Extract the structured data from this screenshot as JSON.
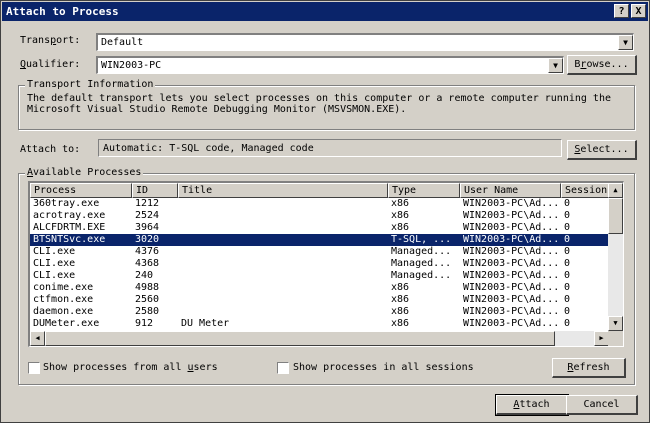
{
  "window": {
    "title": "Attach to Process",
    "help_label": "?",
    "close_label": "X"
  },
  "transport": {
    "label_pre": "Trans",
    "label_key": "p",
    "label_post": "ort:",
    "value": "Default"
  },
  "qualifier": {
    "label_key": "Q",
    "label_post": "ualifier:",
    "value": "WIN2003-PC",
    "browse_pre": "B",
    "browse_key": "r",
    "browse_post": "owse..."
  },
  "transport_info": {
    "title": "Transport Information",
    "line1": "The default transport lets you select processes on this computer or a remote computer running the",
    "line2": "Microsoft Visual Studio Remote Debugging Monitor (MSVSMON.EXE)."
  },
  "attach_to": {
    "label": "Attach to:",
    "value": "Automatic: T-SQL code, Managed code",
    "select_key": "S",
    "select_post": "elect..."
  },
  "available": {
    "title_key": "A",
    "title_post": "vailable Processes",
    "columns": [
      "Process",
      "ID",
      "Title",
      "Type",
      "User Name",
      "Session"
    ],
    "rows": [
      [
        "360tray.exe",
        "1212",
        "",
        "x86",
        "WIN2003-PC\\Ad...",
        "0"
      ],
      [
        "acrotray.exe",
        "2524",
        "",
        "x86",
        "WIN2003-PC\\Ad...",
        "0"
      ],
      [
        "ALCFDRTM.EXE",
        "3964",
        "",
        "x86",
        "WIN2003-PC\\Ad...",
        "0"
      ],
      [
        "BTSNTSvc.exe",
        "3020",
        "",
        "T-SQL, ...",
        "WIN2003-PC\\Ad...",
        "0"
      ],
      [
        "CLI.exe",
        "4376",
        "",
        "Managed...",
        "WIN2003-PC\\Ad...",
        "0"
      ],
      [
        "CLI.exe",
        "4368",
        "",
        "Managed...",
        "WIN2003-PC\\Ad...",
        "0"
      ],
      [
        "CLI.exe",
        "240",
        "",
        "Managed...",
        "WIN2003-PC\\Ad...",
        "0"
      ],
      [
        "conime.exe",
        "4988",
        "",
        "x86",
        "WIN2003-PC\\Ad...",
        "0"
      ],
      [
        "ctfmon.exe",
        "2560",
        "",
        "x86",
        "WIN2003-PC\\Ad...",
        "0"
      ],
      [
        "daemon.exe",
        "2580",
        "",
        "x86",
        "WIN2003-PC\\Ad...",
        "0"
      ],
      [
        "DUMeter.exe",
        "912",
        "DU Meter",
        "x86",
        "WIN2003-PC\\Ad...",
        "0"
      ]
    ],
    "selected_row": 3
  },
  "options": {
    "all_users_pre": "Show processes from all ",
    "all_users_key": "u",
    "all_users_post": "sers",
    "all_sessions_label": "Show processes in all sessions",
    "refresh_key": "R",
    "refresh_post": "efresh"
  },
  "buttons": {
    "attach_key": "A",
    "attach_post": "ttach",
    "cancel": "Cancel"
  }
}
